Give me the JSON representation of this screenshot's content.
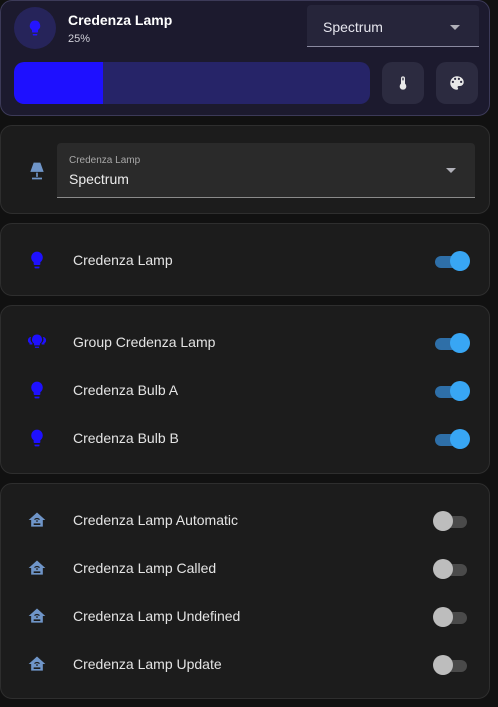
{
  "tile": {
    "name": "Credenza Lamp",
    "state": "25%",
    "effect_value": "Spectrum",
    "brightness_fraction": 0.25,
    "icon": "lightbulb-icon",
    "buttons": [
      "thermometer-icon",
      "palette-icon"
    ]
  },
  "select": {
    "label": "Credenza Lamp",
    "value": "Spectrum",
    "icon": "lamp-icon"
  },
  "light_card": {
    "rows": [
      {
        "label": "Credenza Lamp",
        "icon": "lightbulb-icon",
        "on": true
      }
    ]
  },
  "group_card": {
    "rows": [
      {
        "label": "Group Credenza Lamp",
        "icon": "lightbulb-group-icon",
        "on": true
      },
      {
        "label": "Credenza Bulb A",
        "icon": "lightbulb-icon",
        "on": true
      },
      {
        "label": "Credenza Bulb B",
        "icon": "lightbulb-icon",
        "on": true
      }
    ]
  },
  "automation_card": {
    "rows": [
      {
        "label": "Credenza Lamp Automatic",
        "icon": "home-automation-icon",
        "on": false
      },
      {
        "label": "Credenza Lamp Called",
        "icon": "home-automation-icon",
        "on": false
      },
      {
        "label": "Credenza Lamp Undefined",
        "icon": "home-automation-icon",
        "on": false
      },
      {
        "label": "Credenza Lamp Update",
        "icon": "home-automation-icon",
        "on": false
      }
    ]
  },
  "colors": {
    "accent_light": "#1e10ff",
    "switch_on": "#38a6f4",
    "automation_icon": "#6f95c8"
  }
}
